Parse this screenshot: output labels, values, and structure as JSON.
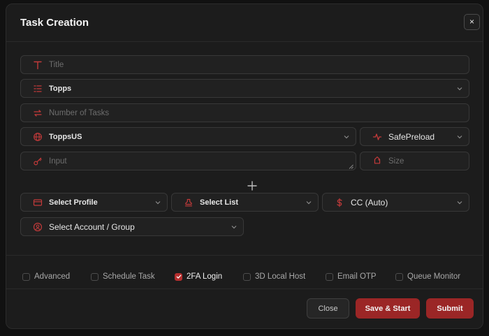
{
  "modal": {
    "title": "Task Creation",
    "close_icon_glyph": "×"
  },
  "fields": {
    "title": {
      "placeholder": "Title",
      "icon": "text-t-icon"
    },
    "site": {
      "value": "Topps",
      "icon": "list-icon"
    },
    "task_count": {
      "placeholder": "Number of Tasks",
      "icon": "repeat-icon"
    },
    "region": {
      "value": "ToppsUS",
      "icon": "globe-icon"
    },
    "mode": {
      "value": "SafePreload",
      "icon": "activity-icon"
    },
    "input": {
      "placeholder": "Input",
      "icon": "key-icon"
    },
    "size": {
      "placeholder": "Size",
      "icon": "tag-icon"
    },
    "profile": {
      "value": "Select Profile",
      "icon": "credit-card-icon"
    },
    "list": {
      "value": "Select List",
      "icon": "stamp-icon"
    },
    "payment": {
      "value": "CC (Auto)",
      "icon": "dollar-icon"
    },
    "account": {
      "value": "Select Account / Group",
      "icon": "user-circle-icon"
    }
  },
  "options": [
    {
      "label": "Advanced",
      "checked": false
    },
    {
      "label": "Schedule Task",
      "checked": false
    },
    {
      "label": "2FA Login",
      "checked": true
    },
    {
      "label": "3D Local Host",
      "checked": false
    },
    {
      "label": "Email OTP",
      "checked": false
    },
    {
      "label": "Queue Monitor",
      "checked": false
    }
  ],
  "actions": {
    "close_label": "Close",
    "save_start_label": "Save & Start",
    "submit_label": "Submit"
  },
  "colors": {
    "accent": "#b52e2e",
    "button_primary": "#9b2626",
    "panel": "#1c1c1c"
  }
}
